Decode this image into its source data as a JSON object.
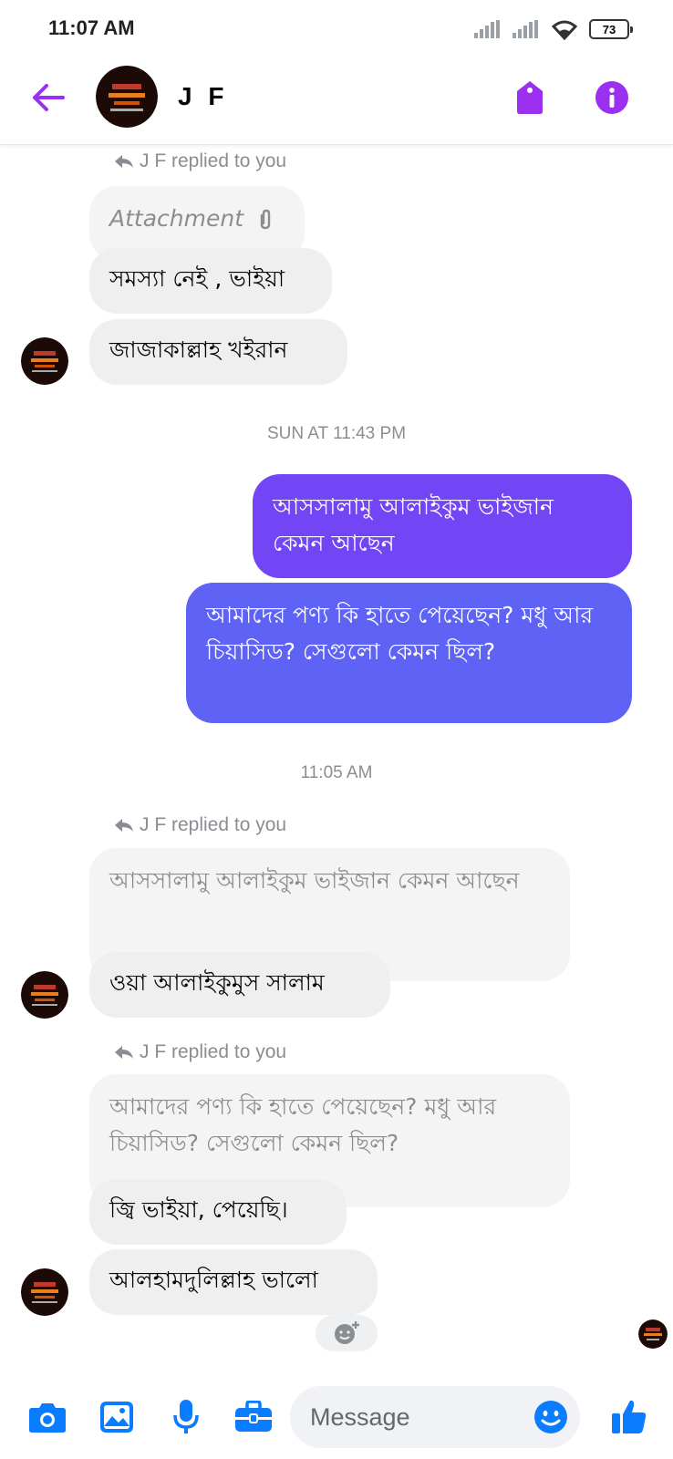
{
  "status_bar": {
    "time": "11:07 AM",
    "battery": "73"
  },
  "header": {
    "contact_name": "J F",
    "back_icon": "arrow-left-icon",
    "tag_icon": "tag-icon",
    "info_icon": "info-icon"
  },
  "colors": {
    "accent": "#9b30f0",
    "outgoing_top": "#7346f5",
    "outgoing_bottom": "#5f63f5",
    "incoming_bg": "#efeff0"
  },
  "messages": {
    "reply_indicator": "J F replied to you",
    "attachment_label": "Attachment",
    "m1": "সমস্যা নেই , ভাইয়া",
    "m2": "জাজাকাল্লাহ খইরান",
    "ts1": "SUN AT 11:43 PM",
    "out1": "আসসালামু আলাইকুম ভাইজান কেমন আছেন",
    "out2": "আমাদের পণ্য কি হাতে পেয়েছেন?  মধু আর চিয়াসিড?  সেগুলো কেমন ছিল?",
    "ts2": "11:05 AM",
    "quote1": "আসসালামু আলাইকুম ভাইজান কেমন আছেন",
    "m3": "ওয়া আলাইকুমুস সালাম",
    "quote2": "আমাদের পণ্য কি হাতে পেয়েছেন?  মধু আর চিয়াসিড?  সেগুলো কেমন ছিল?",
    "m4": "জ্বি ভাইয়া, পেয়েছি।",
    "m5": "আলহামদুলিল্লাহ ভালো"
  },
  "composer": {
    "placeholder": "Message",
    "icons": [
      "camera-icon",
      "image-icon",
      "microphone-icon",
      "briefcase-icon",
      "emoji-icon",
      "thumbs-up-icon"
    ]
  }
}
